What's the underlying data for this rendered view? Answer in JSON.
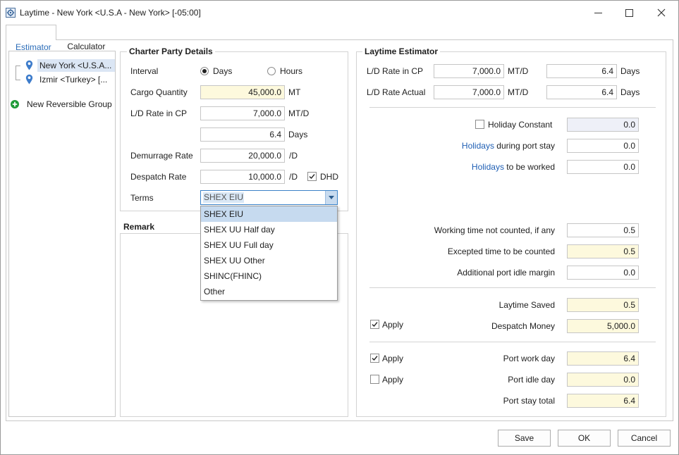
{
  "window": {
    "title": "Laytime - New York <U.S.A - New York> [-05:00]"
  },
  "tabs": [
    {
      "label": "Estimator",
      "active": true
    },
    {
      "label": "Calculator",
      "active": false
    }
  ],
  "tree": {
    "items": [
      {
        "label": "New York <U.S.A...",
        "selected": true,
        "icon": "location-pin-icon"
      },
      {
        "label": "Izmir <Turkey> [...",
        "selected": false,
        "icon": "location-pin-icon"
      }
    ],
    "new_group": {
      "label": "New Reversible Group",
      "icon": "add-circle-icon"
    }
  },
  "charter_party": {
    "title": "Charter Party Details",
    "interval": {
      "label": "Interval",
      "options": [
        "Days",
        "Hours"
      ],
      "selected": "Days"
    },
    "cargo_quantity": {
      "label": "Cargo Quantity",
      "value": "45,000.0",
      "unit": "MT"
    },
    "ld_rate_cp": {
      "label": "L/D Rate in CP",
      "value": "7,000.0",
      "unit": "MT/D"
    },
    "ld_days": {
      "value": "6.4",
      "unit": "Days"
    },
    "demurrage_rate": {
      "label": "Demurrage Rate",
      "value": "20,000.0",
      "unit": "/D"
    },
    "despatch_rate": {
      "label": "Despatch Rate",
      "value": "10,000.0",
      "unit": "/D"
    },
    "dhd": {
      "label": "DHD",
      "checked": true
    },
    "terms": {
      "label": "Terms",
      "value": "SHEX EIU",
      "dropdown_open": true,
      "highlighted_index": 0,
      "options": [
        "SHEX EIU",
        "SHEX UU Half day",
        "SHEX UU Full day",
        "SHEX UU Other",
        "SHINC(FHINC)",
        "Other"
      ]
    }
  },
  "remark": {
    "title": "Remark",
    "value": ""
  },
  "estimator": {
    "title": "Laytime Estimator",
    "ld_rate_cp": {
      "label": "L/D Rate in CP",
      "rate": "7,000.0",
      "rate_unit": "MT/D",
      "days": "6.4",
      "days_unit": "Days"
    },
    "ld_rate_actual": {
      "label": "L/D Rate Actual",
      "rate": "7,000.0",
      "rate_unit": "MT/D",
      "days": "6.4",
      "days_unit": "Days"
    },
    "holiday_constant": {
      "label": "Holiday Constant",
      "checked": false,
      "value": "0.0"
    },
    "holidays_port_stay": {
      "link": "Holidays",
      "rest": " during port stay",
      "value": "0.0"
    },
    "holidays_worked": {
      "link": "Holidays",
      "rest": " to be worked",
      "value": "0.0"
    },
    "working_time_not_counted": {
      "label": "Working time not counted, if any",
      "value": "0.5"
    },
    "excepted_time": {
      "label": "Excepted time to be counted",
      "value": "0.5"
    },
    "idle_margin": {
      "label": "Additional port idle margin",
      "value": "0.0"
    },
    "laytime_saved": {
      "label": "Laytime Saved",
      "value": "0.5"
    },
    "despatch_money": {
      "apply_label": "Apply",
      "apply_checked": true,
      "label": "Despatch Money",
      "value": "5,000.0"
    },
    "port_work_day": {
      "apply_label": "Apply",
      "apply_checked": true,
      "label": "Port work day",
      "value": "6.4"
    },
    "port_idle_day": {
      "apply_label": "Apply",
      "apply_checked": false,
      "label": "Port idle day",
      "value": "0.0"
    },
    "port_stay_total": {
      "label": "Port stay total",
      "value": "6.4"
    }
  },
  "buttons": {
    "save": "Save",
    "ok": "OK",
    "cancel": "Cancel"
  },
  "colors": {
    "accent": "#3b82c8",
    "link": "#1f5fb4",
    "tab_active_text": "#2b6cb8",
    "field_yellow": "#fdf9dd",
    "field_disabled": "#eef0f8",
    "selection": "#dbe6f4",
    "highlight": "#c6daef",
    "pin": "#3d7ccb",
    "add_green": "#1f9b38",
    "field_border": "#c6c6c6",
    "group_border": "#d3d3d3"
  }
}
